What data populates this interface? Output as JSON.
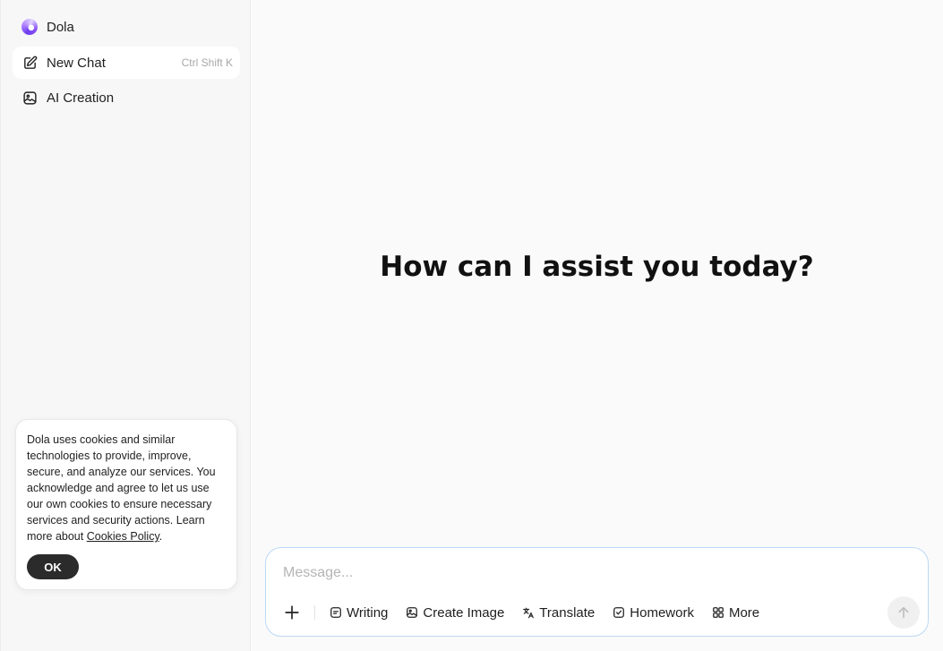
{
  "sidebar": {
    "brand": {
      "label": "Dola",
      "icon": "dola-logo-icon"
    },
    "items": [
      {
        "label": "New Chat",
        "shortcut": "Ctrl Shift K",
        "icon": "edit-icon"
      },
      {
        "label": "AI Creation",
        "icon": "image-icon"
      }
    ]
  },
  "cookie": {
    "text": "Dola uses cookies and similar technologies to provide, improve, secure, and analyze our services. You acknowledge and agree to let us use our own cookies to ensure necessary services and security actions. Learn more about ",
    "link": "Cookies Policy",
    "after_link": ".",
    "ok_label": "OK"
  },
  "main": {
    "greeting": "How can I assist you today?"
  },
  "composer": {
    "placeholder": "Message...",
    "value": "",
    "tools": [
      {
        "label": "Writing",
        "icon": "writing-icon"
      },
      {
        "label": "Create Image",
        "icon": "image-icon"
      },
      {
        "label": "Translate",
        "icon": "translate-icon"
      },
      {
        "label": "Homework",
        "icon": "homework-icon"
      },
      {
        "label": "More",
        "icon": "grid-icon"
      }
    ]
  },
  "colors": {
    "composer_border": "#bcd8f5",
    "ok_button": "#2b2b2b",
    "brand_accent": "#6d3cf0"
  }
}
